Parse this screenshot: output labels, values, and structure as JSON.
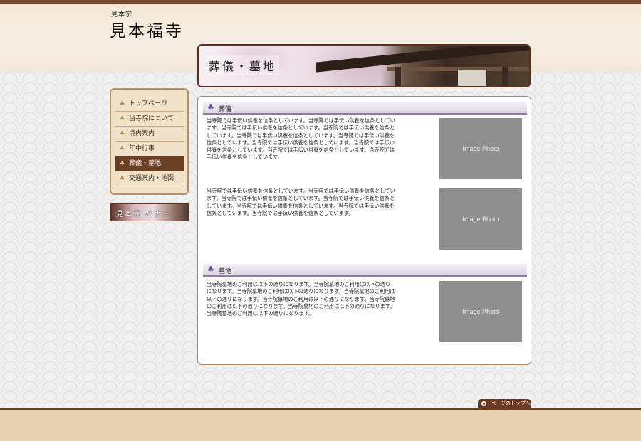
{
  "header": {
    "sect": "見本宗",
    "temple_name": "見本福寺"
  },
  "hero": {
    "title": "葬儀・墓地"
  },
  "sidebar": {
    "items": [
      {
        "label": "トップページ",
        "active": false
      },
      {
        "label": "当寺院について",
        "active": false
      },
      {
        "label": "境内案内",
        "active": false
      },
      {
        "label": "年中行事",
        "active": false
      },
      {
        "label": "葬儀・墓地",
        "active": true
      },
      {
        "label": "交通案内・地図",
        "active": false
      }
    ],
    "banner_text": "見本寺 バナー"
  },
  "main": {
    "section1": {
      "title": "葬儀",
      "para1": "当寺院では手伝い供養を信条としています。当寺院では手伝い供養を信条としています。当寺院では手伝い供養を信条としています。当寺院では手伝い供養を信条としています。当寺院では手伝い供養を信条としています。当寺院では手伝い供養を信条としています。当寺院では手伝い供養を信条としています。当寺院では手伝い供養を信条としています。当寺院では手伝い供養を信条としています。当寺院では手伝い供養を信条としています。",
      "para2": "当寺院では手伝い供養を信条としています。当寺院では手伝い供養を信条としています。当寺院では手伝い供養を信条としています。当寺院では手伝い供養を信条としています。当寺院では手伝い供養を信条としています。当寺院では手伝い供養を信条としています。当寺院では手伝い供養を信条としています。",
      "photo1": "Image Photo",
      "photo2": "Image Photo"
    },
    "section2": {
      "title": "墓地",
      "para": "当寺院墓地のご利用は以下の通りになります。当寺院墓地のご利用は以下の通りになります。当寺院墓地のご利用は以下の通りになります。当寺院墓地のご利用は以下の通りになります。当寺院墓地のご利用は以下の通りになります。当寺院墓地のご利用は以下の通りになります。当寺院墓地のご利用は以下の通りになります。当寺院墓地のご利用は以下の通りになります。",
      "photo": "Image Photo"
    }
  },
  "page_top": {
    "label": "ページのトップへ"
  },
  "colors": {
    "brown": "#6b3a1f",
    "menu_bg": "#efe2c8",
    "accent_purple": "#8f7aa8",
    "photo_gray": "#8f8f8f"
  }
}
